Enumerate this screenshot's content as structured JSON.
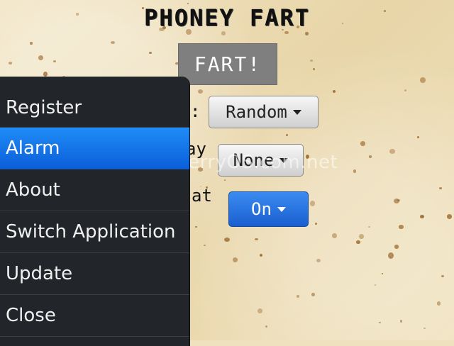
{
  "app": {
    "title": "PHONEY FART",
    "fart_button_label": "FART!"
  },
  "settings": {
    "sound_label_fragment": ":",
    "sound_value": "Random",
    "delay_label_fragment": "ay",
    "delay_value": "None",
    "repeat_label_fragment": "at",
    "repeat_value": "On"
  },
  "menu": {
    "items": [
      {
        "label": "Register"
      },
      {
        "label": "Alarm"
      },
      {
        "label": "About"
      },
      {
        "label": "Switch Application"
      },
      {
        "label": "Update"
      },
      {
        "label": "Close"
      }
    ],
    "selected_index": 1
  },
  "watermark": "BlackBerryOS.com.net",
  "colors": {
    "menu_bg": "#22252a",
    "selected": "#1f8cf7",
    "fart_button": "#7f7f7f",
    "background": "#efe1bd"
  }
}
